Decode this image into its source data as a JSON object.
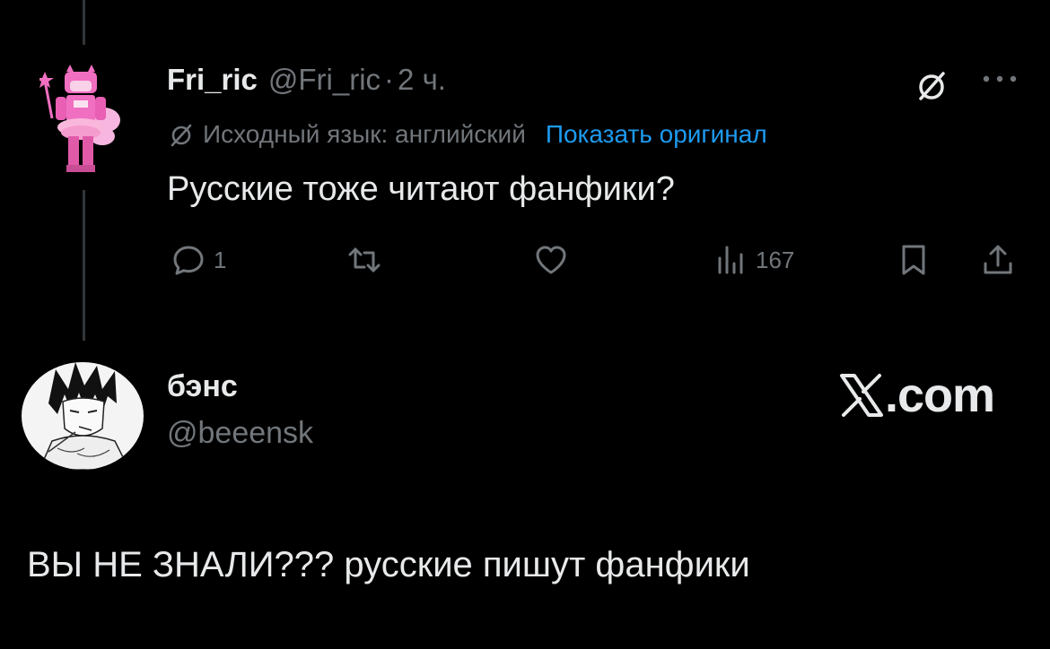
{
  "tweet": {
    "author_name": "Fri_ric",
    "author_handle": "@Fri_ric",
    "separator": "·",
    "time": "2 ч.",
    "translation_label": "Исходный язык: английский",
    "show_original_label": "Показать оригинал",
    "text": "Русские тоже читают фанфики?",
    "actions": {
      "reply_count": "1",
      "views_count": "167"
    },
    "icons": [
      "translate-slash-icon",
      "more-icon",
      "reply-icon",
      "retweet-icon",
      "like-icon",
      "views-icon",
      "bookmark-icon",
      "share-icon"
    ]
  },
  "card": {
    "name": "бэнс",
    "handle": "@beeensk",
    "logo_text": ".com",
    "text": "ВЫ НЕ ЗНАЛИ??? русские пишут фанфики"
  },
  "colors": {
    "background": "#000000",
    "text_primary": "#e7e9ea",
    "text_secondary": "#71767b",
    "accent": "#1d9bf0",
    "thread_line": "#333639",
    "avatar_pink": "#f06fc0"
  }
}
